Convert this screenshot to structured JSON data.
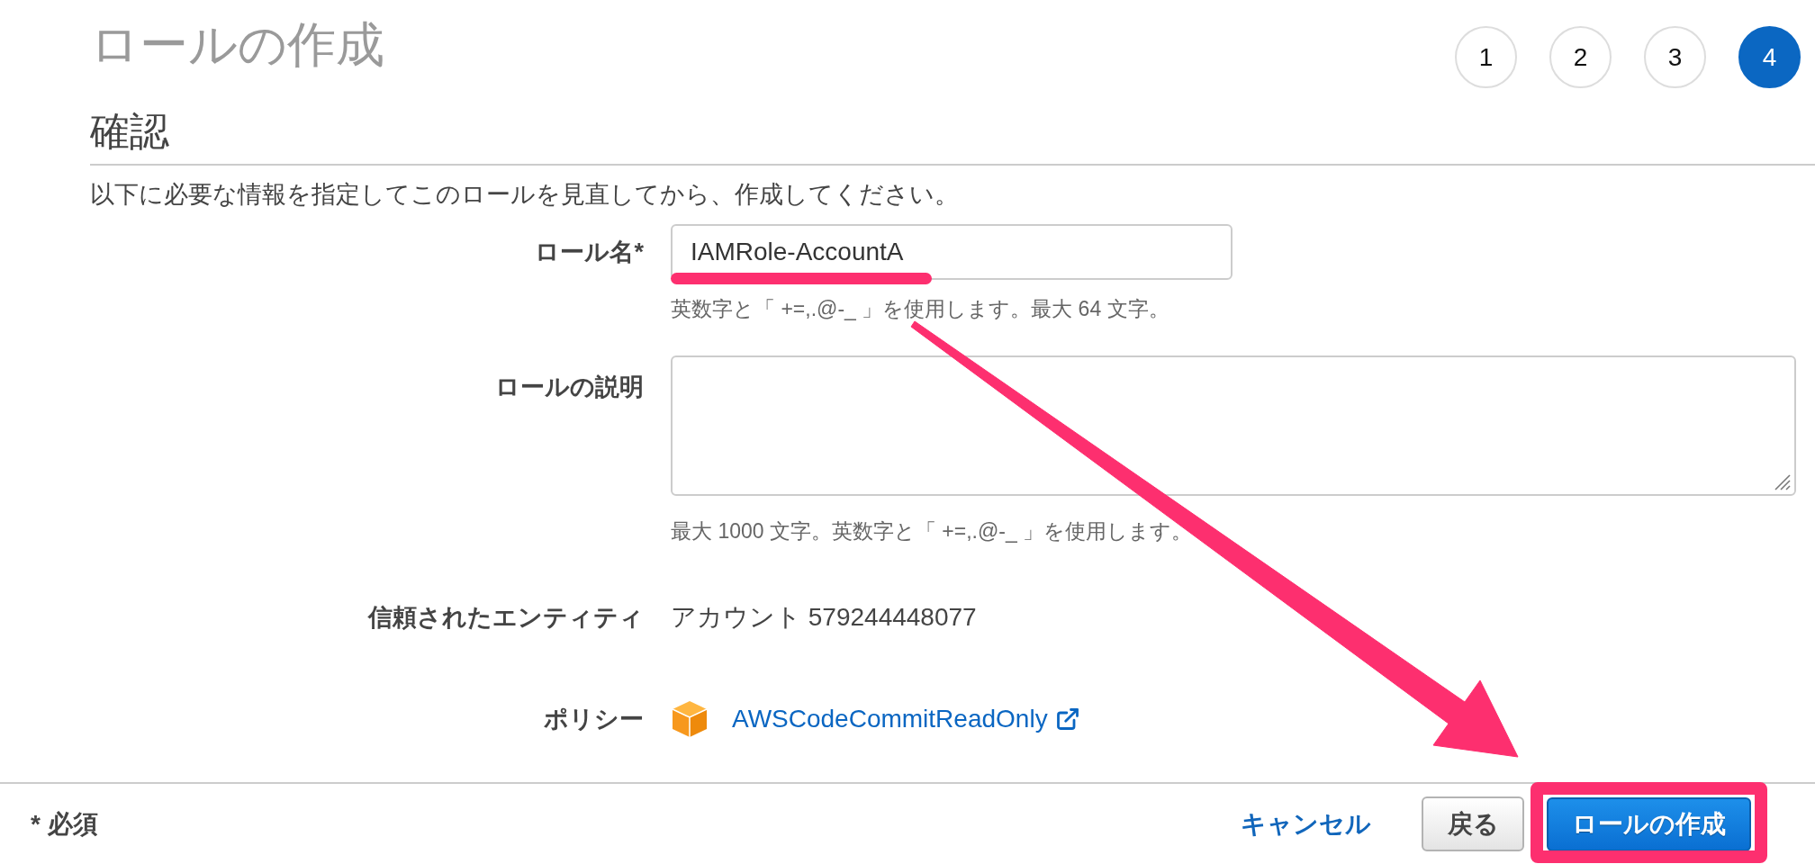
{
  "header": {
    "title": "ロールの作成",
    "steps": [
      {
        "label": "1",
        "selected": false
      },
      {
        "label": "2",
        "selected": false
      },
      {
        "label": "3",
        "selected": false
      },
      {
        "label": "4",
        "selected": true
      }
    ]
  },
  "section": {
    "heading": "確認",
    "intro": "以下に必要な情報を指定してこのロールを見直してから、作成してください。"
  },
  "form": {
    "fields": [
      {
        "kind": "input",
        "label": "ロール名*",
        "value": "IAMRole-AccountA",
        "hint": "英数字と「 +=,.@-_ 」を使用します。最大 64 文字。"
      },
      {
        "kind": "textarea",
        "label": "ロールの説明",
        "hint": "最大 1000 文字。英数字と「 +=,.@-_ 」を使用します。"
      },
      {
        "kind": "text",
        "label": "信頼されたエンティティ",
        "value": "アカウント 579244448077"
      },
      {
        "kind": "policy",
        "label": "ポリシー",
        "link": "AWSCodeCommitReadOnly"
      }
    ]
  },
  "footer": {
    "required_note": "* 必須",
    "actions": [
      {
        "kind": "link",
        "label": "キャンセル"
      },
      {
        "kind": "secondary",
        "label": "戻る"
      },
      {
        "kind": "primary",
        "label": "ロールの作成"
      }
    ]
  }
}
